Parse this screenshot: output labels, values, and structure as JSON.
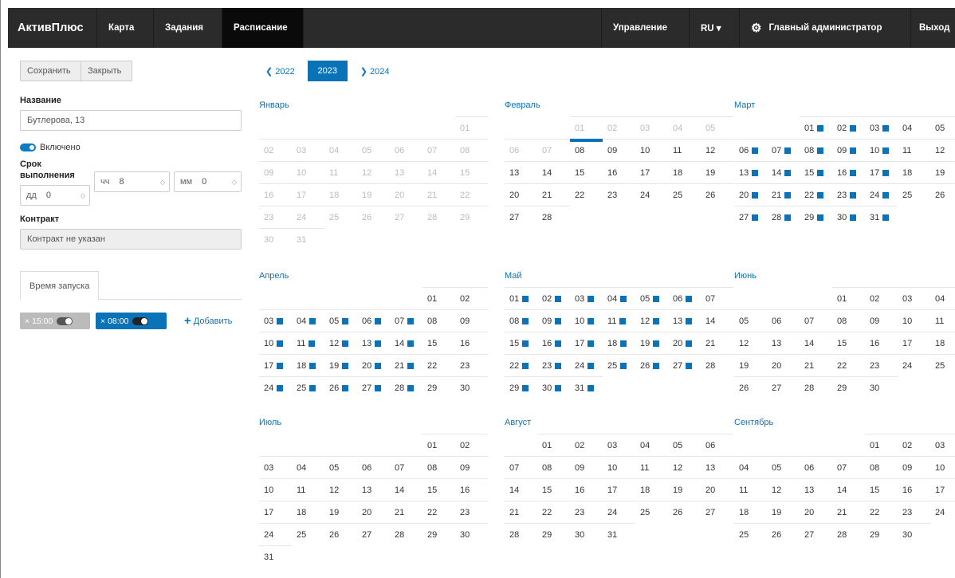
{
  "nav": {
    "brand": "АктивПлюс",
    "items": [
      "Карта",
      "Задания",
      "Расписание"
    ],
    "manage": "Управление",
    "lang": "RU ▾",
    "admin": "Главный администратор",
    "logout": "Выход",
    "gear_icon": "gear-icon"
  },
  "side": {
    "save": "Сохранить",
    "close": "Закрыть",
    "name_label": "Название",
    "name_value": "Бутлерова, 13",
    "enabled": "Включено",
    "deadline_label": "Срок выполнения",
    "dd_unit": "дд",
    "dd_value": "0",
    "hh_unit": "чч",
    "hh_value": "8",
    "mm_unit": "мм",
    "mm_value": "0",
    "contract_label": "Контракт",
    "contract_value": "Контракт не указан",
    "tab": "Время запуска",
    "times": [
      {
        "label": "× 15:00",
        "on": false
      },
      {
        "label": "× 08:00",
        "on": true
      }
    ],
    "add": "Добавить"
  },
  "years": {
    "prev": "2022",
    "current": "2023",
    "next": "2024"
  },
  "accent": "#0a73b8",
  "months": [
    {
      "name": "Январь",
      "offset": 6,
      "days": 31,
      "past_to": 31,
      "marks": []
    },
    {
      "name": "Февраль",
      "offset": 2,
      "days": 28,
      "past_to": 7,
      "today": 8,
      "marks": []
    },
    {
      "name": "Март",
      "offset": 2,
      "days": 31,
      "past_to": 0,
      "marks": [
        1,
        2,
        3,
        6,
        7,
        8,
        9,
        10,
        13,
        14,
        15,
        16,
        17,
        20,
        21,
        22,
        23,
        24,
        27,
        28,
        29,
        30,
        31
      ]
    },
    {
      "name": "Апрель",
      "offset": 5,
      "days": 30,
      "past_to": 0,
      "marks": [
        3,
        4,
        5,
        6,
        7,
        10,
        11,
        12,
        13,
        14,
        17,
        18,
        19,
        20,
        21,
        24,
        25,
        26,
        27,
        28
      ]
    },
    {
      "name": "Май",
      "offset": 0,
      "days": 31,
      "past_to": 0,
      "marks": [
        1,
        2,
        3,
        4,
        5,
        6,
        8,
        9,
        10,
        11,
        12,
        13,
        15,
        16,
        17,
        18,
        19,
        20,
        22,
        23,
        24,
        25,
        26,
        27,
        29,
        30,
        31
      ]
    },
    {
      "name": "Июнь",
      "offset": 3,
      "days": 30,
      "past_to": 0,
      "marks": []
    },
    {
      "name": "Июль",
      "offset": 5,
      "days": 31,
      "past_to": 0,
      "marks": []
    },
    {
      "name": "Август",
      "offset": 1,
      "days": 31,
      "past_to": 0,
      "marks": []
    },
    {
      "name": "Сентябрь",
      "offset": 4,
      "days": 30,
      "past_to": 0,
      "marks": []
    }
  ]
}
